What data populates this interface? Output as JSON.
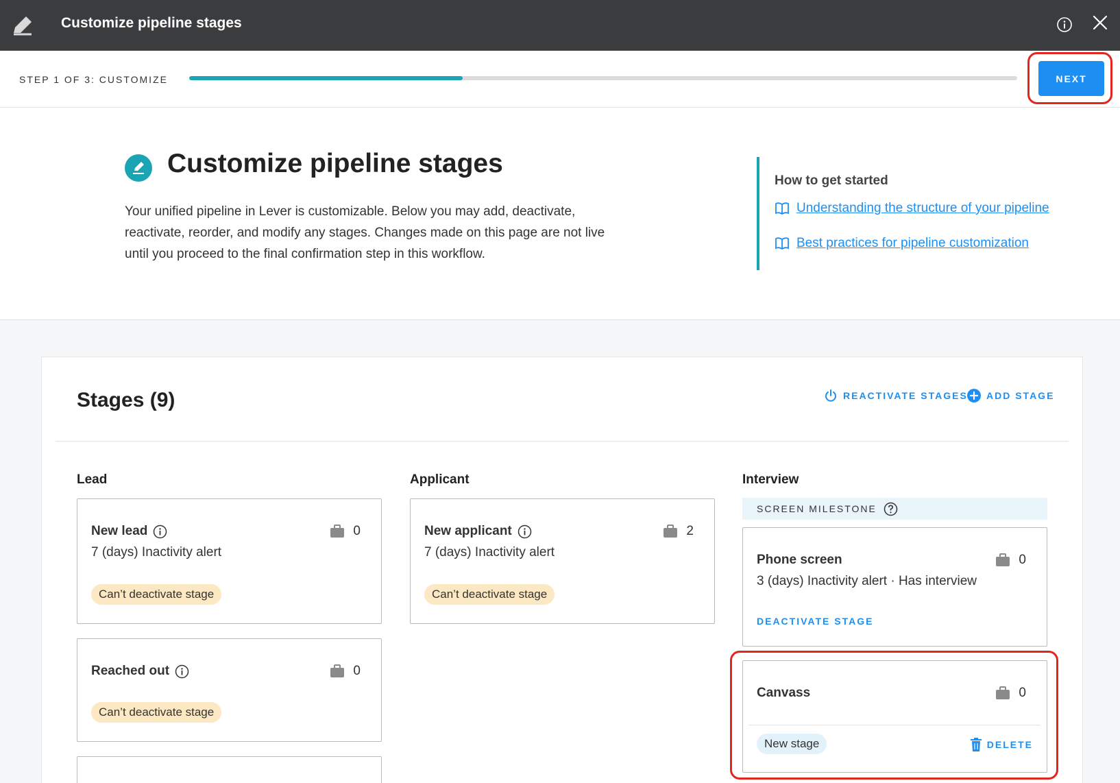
{
  "window": {
    "title": "Customize pipeline stages",
    "app_icon": "pencil-icon",
    "info_icon": "info-icon",
    "close_icon": "close-icon"
  },
  "stepper": {
    "label": "STEP 1 OF 3: CUSTOMIZE",
    "progress_percent": 33,
    "next_label": "NEXT"
  },
  "intro": {
    "title": "Customize pipeline stages",
    "description": "Your unified pipeline in Lever is customizable. Below you may add, deactivate, reactivate, reorder, and modify any stages. Changes made on this page are not live until you proceed to the final confirmation step in this workflow.",
    "help_title": "How to get started",
    "links": [
      {
        "label": "Understanding the structure of your pipeline",
        "icon": "book-icon"
      },
      {
        "label": "Best practices for pipeline customization",
        "icon": "book-icon"
      }
    ]
  },
  "stages": {
    "title": "Stages (9)",
    "reactivate_label": "REACTIVATE STAGES",
    "add_label": "ADD STAGE",
    "columns": [
      {
        "label": "Lead"
      },
      {
        "label": "Applicant"
      },
      {
        "label": "Interview"
      }
    ],
    "milestone_label": "SCREEN MILESTONE",
    "lead_stages": [
      {
        "name": "New lead",
        "count": "0",
        "alert": "7 (days) Inactivity alert",
        "badge": "Can’t deactivate stage"
      },
      {
        "name": "Reached out",
        "count": "0",
        "alert": "",
        "badge": "Can’t deactivate stage"
      }
    ],
    "applicant_stages": [
      {
        "name": "New applicant",
        "count": "2",
        "alert": "7 (days) Inactivity alert",
        "badge": "Can’t deactivate stage"
      }
    ],
    "interview_stages": [
      {
        "name": "Phone screen",
        "count": "0",
        "alert": "3 (days) Inactivity alert · Has interview",
        "action": "DEACTIVATE STAGE"
      },
      {
        "name": "Canvass",
        "count": "0",
        "badge": "New stage",
        "action": "DELETE"
      }
    ]
  },
  "colors": {
    "topbar": "#3b3c3e",
    "accent_teal": "#1ba4b4",
    "primary_blue": "#1d8ff3",
    "highlight_red": "#e2261f"
  }
}
